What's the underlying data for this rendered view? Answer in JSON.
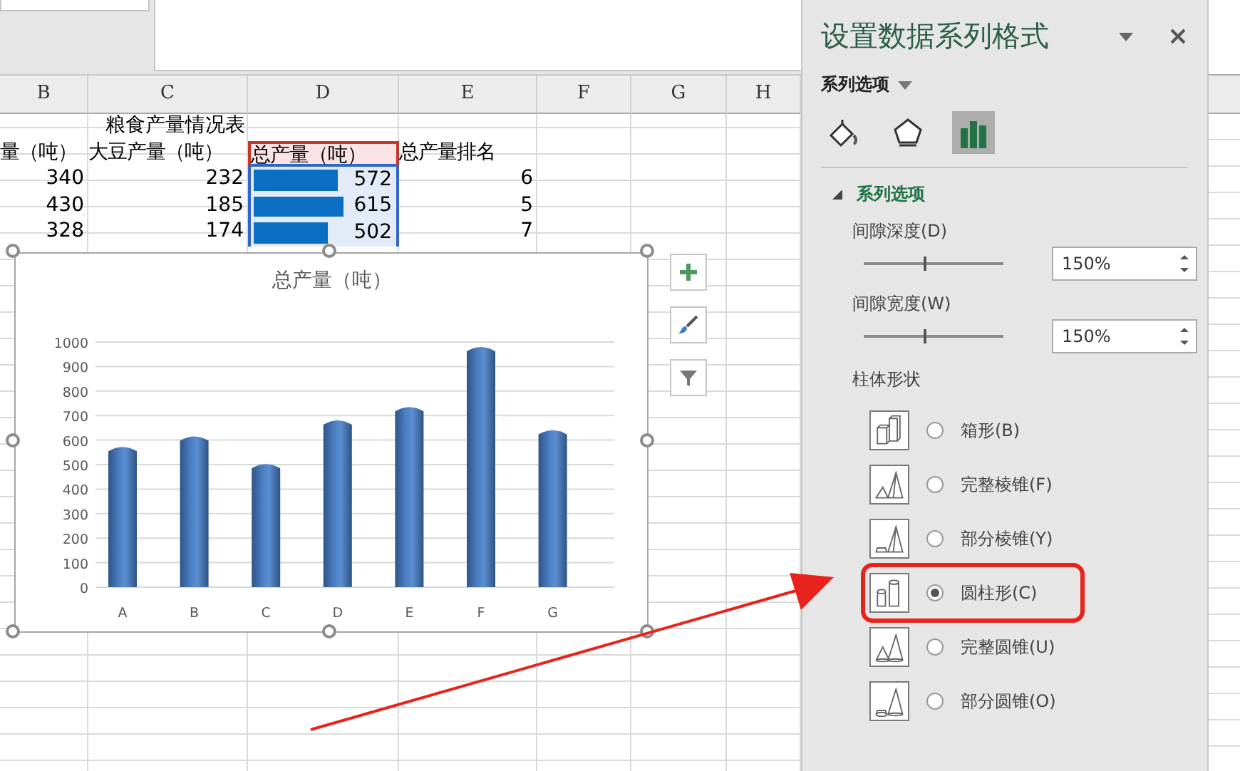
{
  "sheet": {
    "columns": [
      "B",
      "C",
      "D",
      "E",
      "F",
      "G",
      "H"
    ],
    "title": "粮食产量情况表",
    "headers": [
      {
        "text": "量（吨）",
        "selected": false
      },
      {
        "text": "大豆产量（吨）",
        "selected": false
      },
      {
        "text": "总产量（吨）",
        "selected": true
      },
      {
        "text": "总产量排名",
        "selected": false
      }
    ],
    "rows": [
      {
        "cells": [
          {
            "text": "340"
          },
          {
            "text": "232"
          },
          {
            "text": "572",
            "level": 0.58
          },
          {
            "text": "6"
          }
        ]
      },
      {
        "cells": [
          {
            "text": "430"
          },
          {
            "text": "185"
          },
          {
            "text": "615",
            "level": 0.62
          },
          {
            "text": "5"
          }
        ]
      },
      {
        "cells": [
          {
            "text": "328"
          },
          {
            "text": "174"
          },
          {
            "text": "502",
            "level": 0.51
          },
          {
            "text": "7"
          }
        ]
      }
    ]
  },
  "chart": {
    "chart_data": {
      "type": "bar",
      "title": "总产量（吨）",
      "categories": [
        "A",
        "B",
        "C",
        "D",
        "E",
        "F",
        "G"
      ],
      "values": [
        572,
        615,
        502,
        680,
        735,
        980,
        640
      ],
      "grid": true,
      "ylim": [
        0,
        1000
      ],
      "yticks": [
        0,
        100,
        200,
        300,
        400,
        500,
        600,
        700,
        800,
        900,
        1000
      ]
    }
  },
  "panel": {
    "title": "设置数据系列格式",
    "menu_label": "系列选项",
    "tabs": [
      {
        "kind": "fill",
        "selected": false
      },
      {
        "kind": "effects",
        "selected": false
      },
      {
        "kind": "series",
        "selected": true
      }
    ],
    "section": {
      "title": "系列选项",
      "expanded": true
    },
    "settings": [
      {
        "label": "间隙深度(D)",
        "level": 0.43,
        "value": "150%"
      },
      {
        "label": "间隙宽度(W)",
        "level": 0.43,
        "value": "150%"
      }
    ],
    "shape_label": "柱体形状",
    "shapes": [
      {
        "kind": "box",
        "label": "箱形(B)",
        "selected": false,
        "highlighted": false
      },
      {
        "kind": "pyramid",
        "label": "完整棱锥(F)",
        "selected": false,
        "highlighted": false
      },
      {
        "kind": "partial-pyramid",
        "label": "部分棱锥(Y)",
        "selected": false,
        "highlighted": false
      },
      {
        "kind": "cylinder",
        "label": "圆柱形(C)",
        "selected": true,
        "highlighted": true
      },
      {
        "kind": "cone",
        "label": "完整圆锥(U)",
        "selected": false,
        "highlighted": false
      },
      {
        "kind": "partial-cone",
        "label": "部分圆锥(O)",
        "selected": false,
        "highlighted": false
      }
    ]
  }
}
